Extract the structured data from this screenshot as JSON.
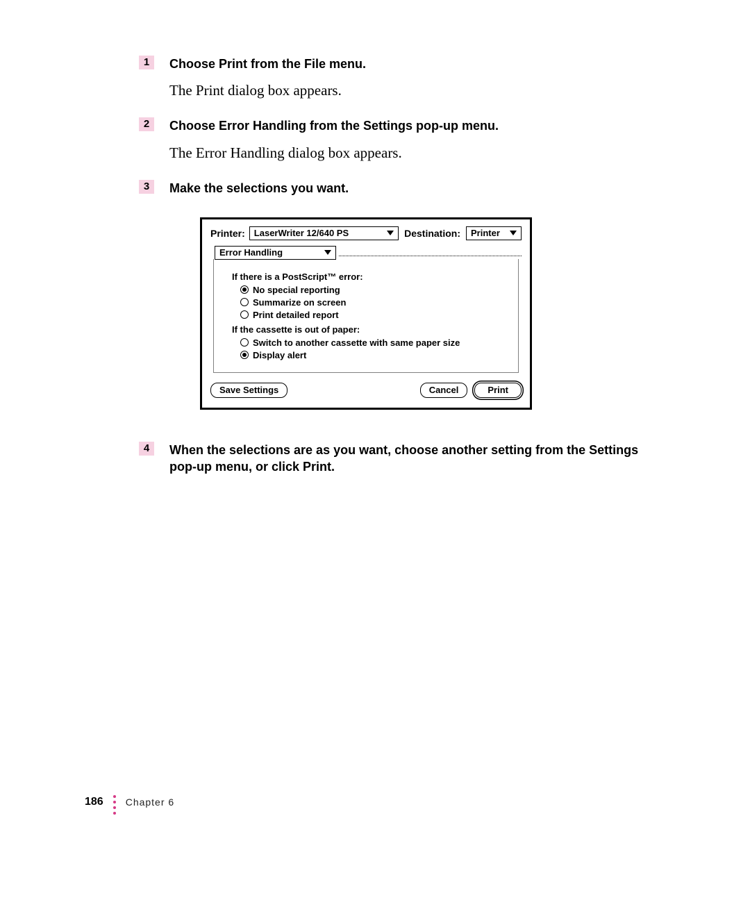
{
  "steps": [
    {
      "num": "1",
      "heading": "Choose Print from the File menu.",
      "text": "The Print dialog box appears."
    },
    {
      "num": "2",
      "heading": "Choose Error Handling from the Settings pop-up menu.",
      "text": "The Error Handling dialog box appears."
    },
    {
      "num": "3",
      "heading": "Make the selections you want.",
      "text": ""
    },
    {
      "num": "4",
      "heading": "When the selections are as you want, choose another setting from the Settings pop-up menu, or click Print.",
      "text": ""
    }
  ],
  "dialog": {
    "printer_label": "Printer:",
    "printer_value": "LaserWriter 12/640 PS",
    "destination_label": "Destination:",
    "destination_value": "Printer",
    "settings_value": "Error Handling",
    "group1_title": "If there is a PostScript™ error:",
    "group1_options": [
      {
        "label": "No special reporting",
        "selected": true
      },
      {
        "label": "Summarize on screen",
        "selected": false
      },
      {
        "label": "Print detailed report",
        "selected": false
      }
    ],
    "group2_title": "If the cassette is out of paper:",
    "group2_options": [
      {
        "label": "Switch to another cassette with same paper size",
        "selected": false
      },
      {
        "label": "Display alert",
        "selected": true
      }
    ],
    "save_btn": "Save Settings",
    "cancel_btn": "Cancel",
    "print_btn": "Print"
  },
  "footer": {
    "page_num": "186",
    "chapter": "Chapter 6"
  }
}
